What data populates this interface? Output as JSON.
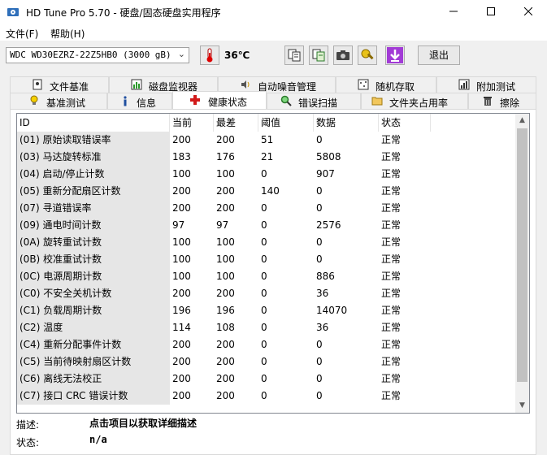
{
  "window": {
    "title": "HD Tune Pro 5.70 - 硬盘/固态硬盘实用程序"
  },
  "menu": {
    "file": "文件(F)",
    "help": "帮助(H)"
  },
  "toolbar": {
    "drive": "WDC WD30EZRZ-22Z5HB0 (3000 gB)",
    "temperature": "36℃",
    "exit_label": "退出"
  },
  "tabs_row1": [
    {
      "label": "文件基准",
      "icon": "file-benchmark-icon"
    },
    {
      "label": "磁盘监视器",
      "icon": "disk-monitor-icon"
    },
    {
      "label": "自动噪音管理",
      "icon": "speaker-icon"
    },
    {
      "label": "随机存取",
      "icon": "random-access-icon"
    },
    {
      "label": "附加测试",
      "icon": "extra-tests-icon"
    }
  ],
  "tabs_row2": [
    {
      "label": "基准测试",
      "icon": "lightbulb-icon"
    },
    {
      "label": "信息",
      "icon": "info-icon"
    },
    {
      "label": "健康状态",
      "icon": "health-cross-icon"
    },
    {
      "label": "错误扫描",
      "icon": "magnifier-icon"
    },
    {
      "label": "文件夹占用率",
      "icon": "folder-icon"
    },
    {
      "label": "擦除",
      "icon": "trash-icon"
    }
  ],
  "table": {
    "columns": [
      "ID",
      "当前",
      "最差",
      "阈值",
      "数据",
      "状态"
    ],
    "rows": [
      [
        "(01) 原始读取错误率",
        "200",
        "200",
        "51",
        "0",
        "正常"
      ],
      [
        "(03) 马达旋转标准",
        "183",
        "176",
        "21",
        "5808",
        "正常"
      ],
      [
        "(04) 启动/停止计数",
        "100",
        "100",
        "0",
        "907",
        "正常"
      ],
      [
        "(05) 重新分配扇区计数",
        "200",
        "200",
        "140",
        "0",
        "正常"
      ],
      [
        "(07) 寻道错误率",
        "200",
        "200",
        "0",
        "0",
        "正常"
      ],
      [
        "(09) 通电时间计数",
        "97",
        "97",
        "0",
        "2576",
        "正常"
      ],
      [
        "(0A) 旋转重试计数",
        "100",
        "100",
        "0",
        "0",
        "正常"
      ],
      [
        "(0B) 校准重试计数",
        "100",
        "100",
        "0",
        "0",
        "正常"
      ],
      [
        "(0C) 电源周期计数",
        "100",
        "100",
        "0",
        "886",
        "正常"
      ],
      [
        "(C0) 不安全关机计数",
        "200",
        "200",
        "0",
        "36",
        "正常"
      ],
      [
        "(C1) 负载周期计数",
        "196",
        "196",
        "0",
        "14070",
        "正常"
      ],
      [
        "(C2) 温度",
        "114",
        "108",
        "0",
        "36",
        "正常"
      ],
      [
        "(C4) 重新分配事件计数",
        "200",
        "200",
        "0",
        "0",
        "正常"
      ],
      [
        "(C5) 当前待映射扇区计数",
        "200",
        "200",
        "0",
        "0",
        "正常"
      ],
      [
        "(C6) 离线无法校正",
        "200",
        "200",
        "0",
        "0",
        "正常"
      ],
      [
        "(C7) 接口 CRC 错误计数",
        "200",
        "200",
        "0",
        "0",
        "正常"
      ]
    ]
  },
  "info": {
    "desc_label": "描述:",
    "desc_value": "点击项目以获取详细描述",
    "status_label": "状态:",
    "status_value": "n/a"
  }
}
